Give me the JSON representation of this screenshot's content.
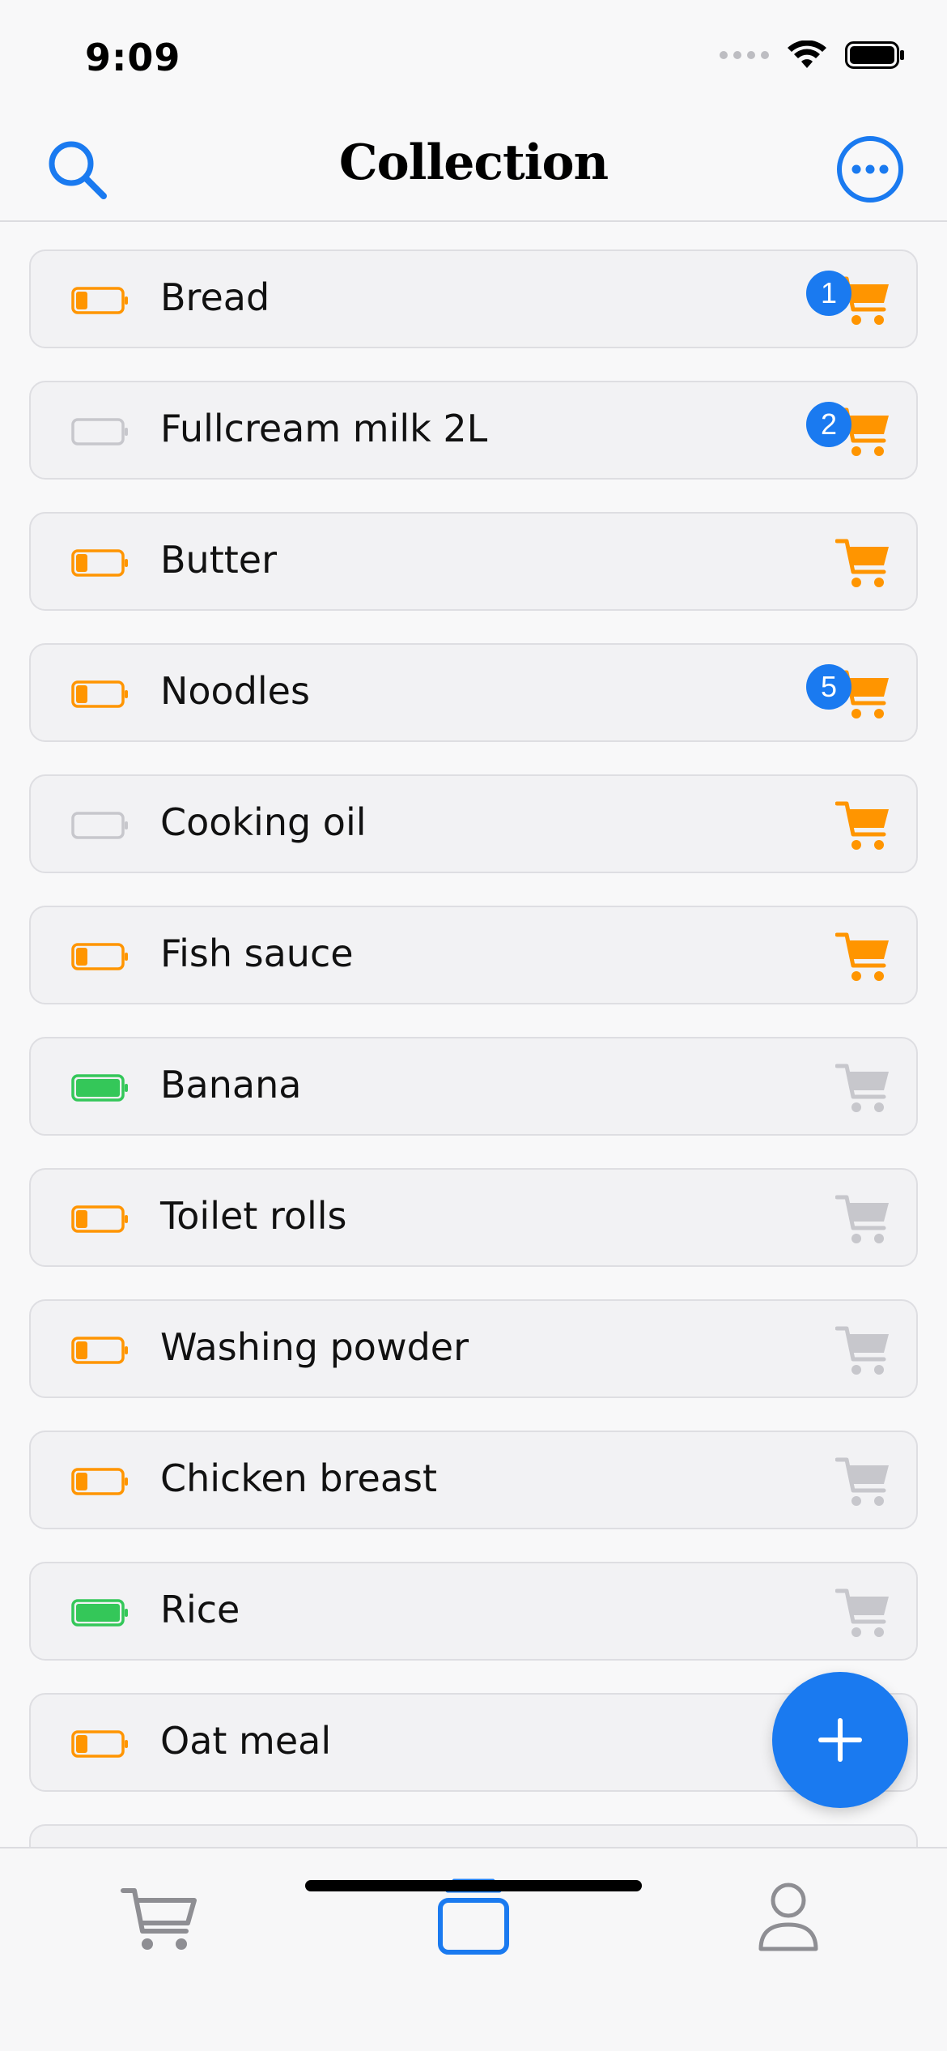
{
  "status_bar": {
    "time": "9:09"
  },
  "nav": {
    "title": "Collection",
    "search_icon": "search-icon",
    "more_icon": "ellipsis-circle-icon"
  },
  "colors": {
    "accent": "#1A7AF0",
    "orange": "#FF9500",
    "green": "#34C759",
    "gray": "#C7C7CC"
  },
  "items": [
    {
      "name": "Bread",
      "level": "low",
      "in_cart": true,
      "cart_count": "1"
    },
    {
      "name": "Fullcream milk 2L",
      "level": "empty",
      "in_cart": true,
      "cart_count": "2"
    },
    {
      "name": "Butter",
      "level": "low",
      "in_cart": true,
      "cart_count": ""
    },
    {
      "name": "Noodles",
      "level": "low",
      "in_cart": true,
      "cart_count": "5"
    },
    {
      "name": "Cooking oil",
      "level": "empty",
      "in_cart": true,
      "cart_count": ""
    },
    {
      "name": "Fish sauce",
      "level": "low",
      "in_cart": true,
      "cart_count": ""
    },
    {
      "name": "Banana",
      "level": "full",
      "in_cart": false,
      "cart_count": ""
    },
    {
      "name": "Toilet rolls",
      "level": "low",
      "in_cart": false,
      "cart_count": ""
    },
    {
      "name": "Washing powder",
      "level": "low",
      "in_cart": false,
      "cart_count": ""
    },
    {
      "name": "Chicken breast",
      "level": "low",
      "in_cart": false,
      "cart_count": ""
    },
    {
      "name": "Rice",
      "level": "full",
      "in_cart": false,
      "cart_count": ""
    },
    {
      "name": "Oat meal",
      "level": "low",
      "in_cart": false,
      "cart_count": ""
    }
  ],
  "fab": {
    "icon": "plus-icon"
  },
  "tab_bar": {
    "tabs": [
      {
        "icon": "cart-icon",
        "selected": false
      },
      {
        "icon": "collection-stack-icon",
        "selected": true
      },
      {
        "icon": "person-icon",
        "selected": false
      }
    ]
  }
}
